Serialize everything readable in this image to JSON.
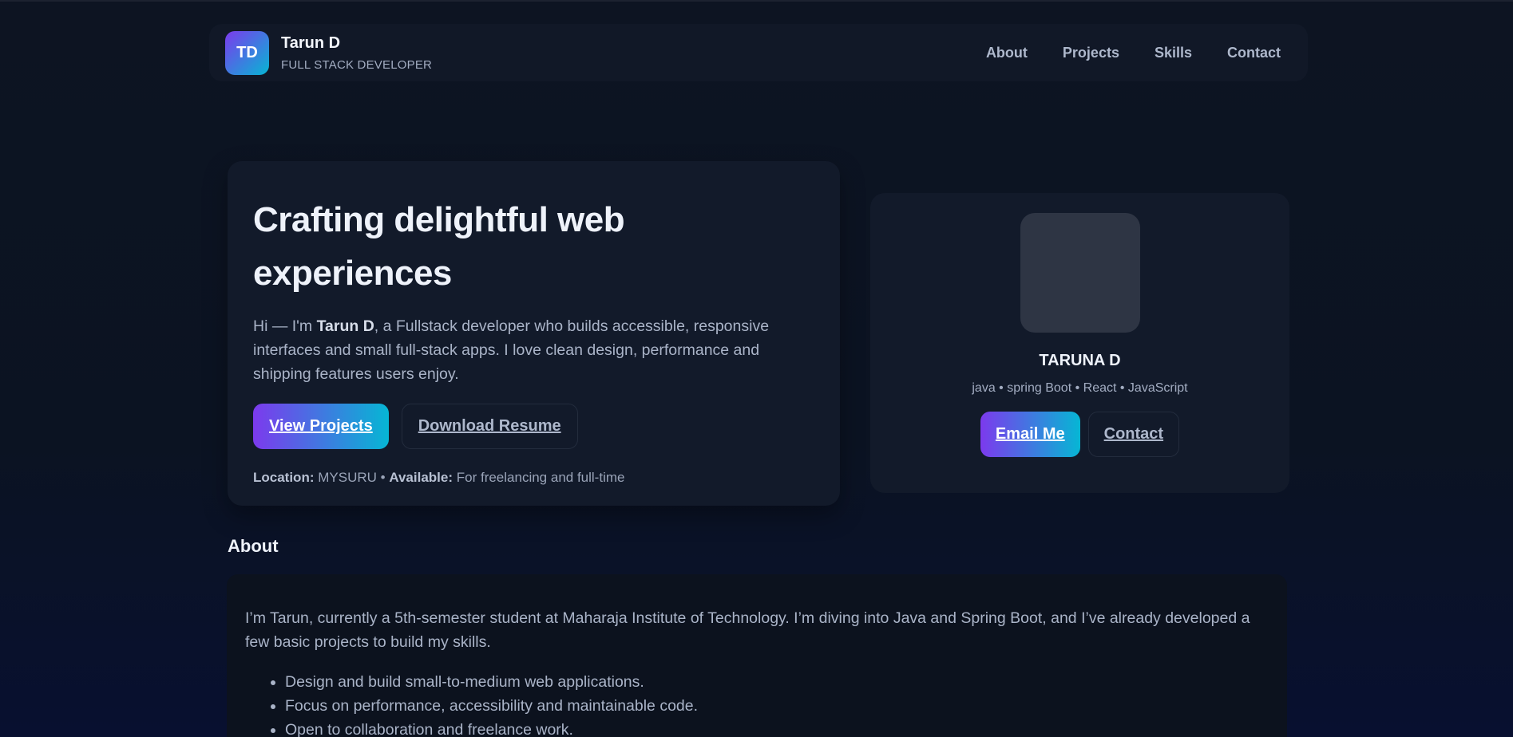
{
  "header": {
    "logo_initials": "TD",
    "name": "Tarun D",
    "subtitle": "FULL STACK DEVELOPER",
    "nav": [
      "About",
      "Projects",
      "Skills",
      "Contact"
    ]
  },
  "hero": {
    "title": "Crafting delightful web experiences",
    "intro_prefix": "Hi — I'm ",
    "intro_name": "Tarun D",
    "intro_suffix": ", a Fullstack developer who builds accessible, responsive interfaces and small full-stack apps. I love clean design, performance and shipping features users enjoy.",
    "primary_button": "View Projects",
    "secondary_button": "Download Resume",
    "location_label": "Location:",
    "location_value": "MYSURU",
    "separator": "•",
    "available_label": "Available:",
    "available_value": "For freelancing and full-time"
  },
  "profile": {
    "name": "TARUNA D",
    "skills": "java • spring Boot • React • JavaScript",
    "email_button": "Email Me",
    "contact_button": "Contact"
  },
  "about": {
    "title": "About",
    "text": "I’m Tarun, currently a 5th-semester student at Maharaja Institute of Technology. I’m diving into Java and Spring Boot, and I’ve already developed a few basic projects to build my skills.",
    "items": [
      "Design and build small-to-medium web applications.",
      "Focus on performance, accessibility and maintainable code.",
      "Open to collaboration and freelance work."
    ]
  },
  "colors": {
    "background": "#0d1422",
    "card": "#121a2a",
    "gradient_start": "#7c3aed",
    "gradient_end": "#06b6d4"
  }
}
